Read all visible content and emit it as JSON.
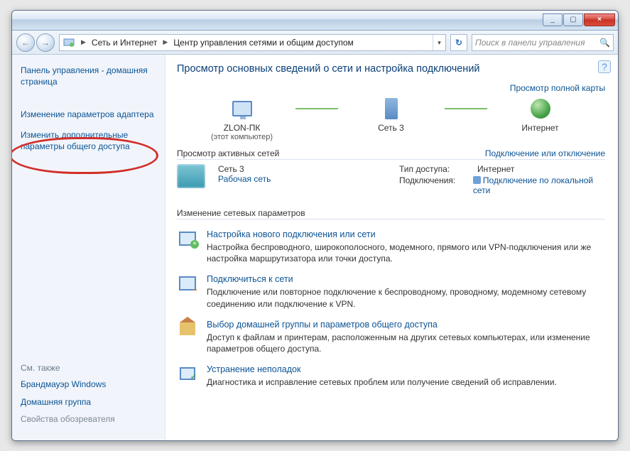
{
  "window": {
    "min_tip": "_",
    "max_tip": "▢",
    "close_tip": "×"
  },
  "nav": {
    "back": "←",
    "fwd": "→"
  },
  "breadcrumb": {
    "item1": "Сеть и Интернет",
    "item2": "Центр управления сетями и общим доступом"
  },
  "search": {
    "placeholder": "Поиск в панели управления",
    "icon": "🔍"
  },
  "refresh": "↻",
  "sidebar": {
    "home": "Панель управления - домашняя страница",
    "adapter": "Изменение параметров адаптера",
    "sharing": "Изменить дополнительные параметры общего доступа",
    "seealso_h": "См. также",
    "firewall": "Брандмауэр Windows",
    "homegroup": "Домашняя группа",
    "inetopts": "Свойства обозревателя"
  },
  "main": {
    "heading": "Просмотр основных сведений о сети и настройка подключений",
    "fullmap": "Просмотр полной карты",
    "map": {
      "n1": "ZLON-ПК",
      "n1sub": "(этот компьютер)",
      "n2": "Сеть 3",
      "n3": "Интернет"
    },
    "active": {
      "title": "Просмотр активных сетей",
      "toggle": "Подключение или отключение",
      "name": "Сеть 3",
      "type": "Рабочая сеть",
      "access_k": "Тип доступа:",
      "access_v": "Интернет",
      "conn_k": "Подключения:",
      "conn_v": "Подключение по локальной сети"
    },
    "params_title": "Изменение сетевых параметров",
    "tasks": [
      {
        "head": "Настройка нового подключения или сети",
        "desc": "Настройка беспроводного, широкополосного, модемного, прямого или VPN-подключения или же настройка маршрутизатора или точки доступа."
      },
      {
        "head": "Подключиться к сети",
        "desc": "Подключение или повторное подключение к беспроводному, проводному, модемному сетевому соединению или подключение к VPN."
      },
      {
        "head": "Выбор домашней группы и параметров общего доступа",
        "desc": "Доступ к файлам и принтерам, расположенным на других сетевых компьютерах, или изменение параметров общего доступа."
      },
      {
        "head": "Устранение неполадок",
        "desc": "Диагностика и исправление сетевых проблем или получение сведений об исправлении."
      }
    ]
  },
  "help": "?"
}
